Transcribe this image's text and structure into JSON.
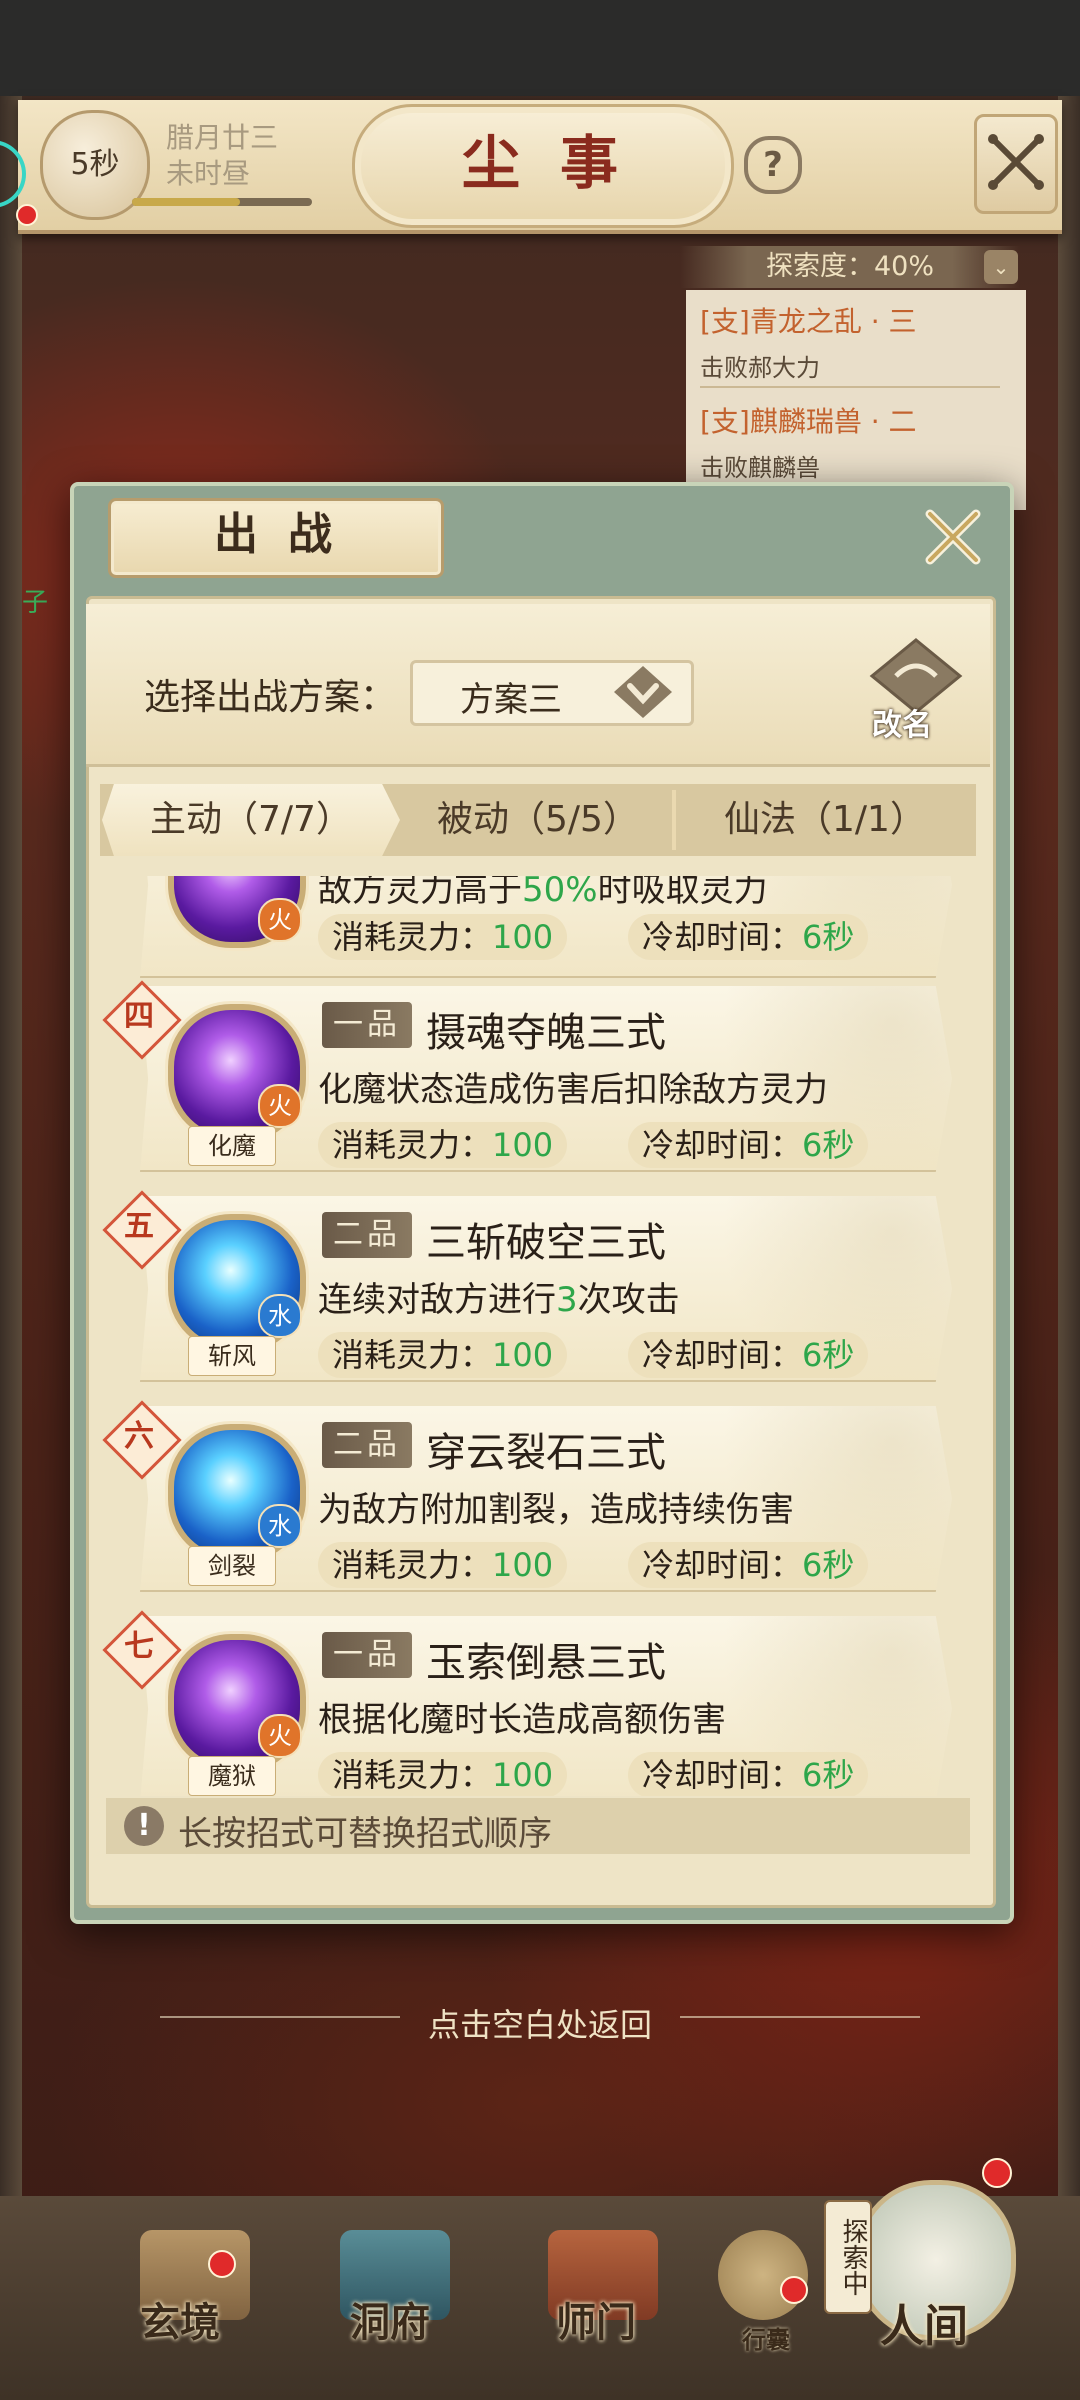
{
  "header": {
    "timer": "5秒",
    "date_line1": "腊月廿三",
    "date_line2": "未时昼",
    "title": "尘事",
    "help": "?"
  },
  "quest_panel": {
    "explore": "探索度：40%",
    "quests": [
      {
        "name": "[支]青龙之乱 · 三",
        "sub": "击败郝大力"
      },
      {
        "name": "[支]麒麟瑞兽 · 二",
        "sub": "击败麒麟兽"
      }
    ]
  },
  "side_text": "子",
  "dialog": {
    "title": "出战",
    "plan_label": "选择出战方案：",
    "plan_value": "方案三",
    "rename": "改名",
    "tabs": [
      "主动（7/7）",
      "被动（5/5）",
      "仙法（1/1）"
    ],
    "active_tab": 0,
    "cost_label": "消耗灵力：",
    "cd_label": "冷却时间：",
    "skills": [
      {
        "rank": "",
        "grade": "",
        "name": "",
        "desc_pre": "敌方灵力高于",
        "desc_hl": "50%",
        "desc_post": "时吸取灵力",
        "elem": "火",
        "elem_type": "fire",
        "icon_label": "",
        "cost": "100",
        "cd": "6秒",
        "color": "purple"
      },
      {
        "rank": "四",
        "grade": "一品",
        "name": "摄魂夺魄三式",
        "desc_pre": "化魔状态造成伤害后扣除敌方灵力",
        "desc_hl": "",
        "desc_post": "",
        "elem": "火",
        "elem_type": "fire",
        "icon_label": "化魔",
        "cost": "100",
        "cd": "6秒",
        "color": "purple"
      },
      {
        "rank": "五",
        "grade": "二品",
        "name": "三斩破空三式",
        "desc_pre": "连续对敌方进行",
        "desc_hl": "3",
        "desc_post": "次攻击",
        "elem": "水",
        "elem_type": "water",
        "icon_label": "斩风",
        "cost": "100",
        "cd": "6秒",
        "color": "blue"
      },
      {
        "rank": "六",
        "grade": "二品",
        "name": "穿云裂石三式",
        "desc_pre": "为敌方附加割裂，造成持续伤害",
        "desc_hl": "",
        "desc_post": "",
        "elem": "水",
        "elem_type": "water",
        "icon_label": "剑裂",
        "cost": "100",
        "cd": "6秒",
        "color": "blue"
      },
      {
        "rank": "七",
        "grade": "一品",
        "name": "玉索倒悬三式",
        "desc_pre": "根据化魔时长造成高额伤害",
        "desc_hl": "",
        "desc_post": "",
        "elem": "火",
        "elem_type": "fire",
        "icon_label": "魔狱",
        "cost": "100",
        "cd": "6秒",
        "color": "purple"
      }
    ],
    "hint": "长按招式可替换招式顺序"
  },
  "back_hint": "点击空白处返回",
  "nav": {
    "items": [
      "玄境",
      "洞府",
      "师门",
      "行囊"
    ],
    "explore_tag": "探索中",
    "world": "人间"
  }
}
